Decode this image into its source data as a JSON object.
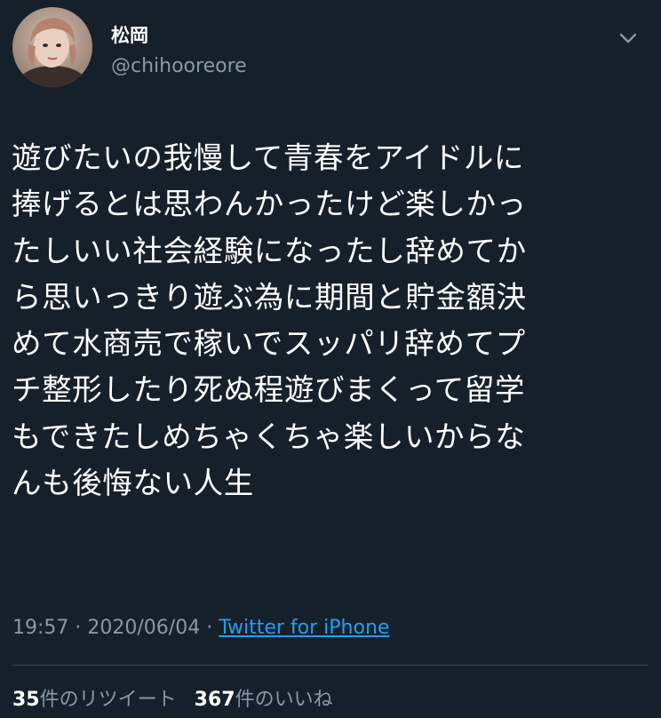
{
  "tweet": {
    "author": {
      "display_name": "松岡",
      "handle": "@chihooreore",
      "avatar_icon": "avatar-photo"
    },
    "menu_icon": "chevron-down-icon",
    "body_lines": [
      "遊びたいの我慢して青春をアイドルに",
      "捧げるとは思わんかったけど楽しかっ",
      "たしいい社会経験になったし辞めてか",
      "ら思いっきり遊ぶ為に期間と貯金額決",
      "めて水商売で稼いでスッパリ辞めてプ",
      "チ整形したり死ぬ程遊びまくって留学",
      "もできたしめちゃくちゃ楽しいからな",
      "んも後悔ない人生"
    ],
    "meta": {
      "time": "19:57",
      "separator": " · ",
      "date": "2020/06/04",
      "source": "Twitter for iPhone"
    },
    "stats": {
      "retweets_count": "35",
      "retweets_label": "件のリツイート",
      "likes_count": "367",
      "likes_label": "件のいいね"
    }
  },
  "colors": {
    "background": "#15202b",
    "text_primary": "#ffffff",
    "text_secondary": "#8899a6",
    "link": "#1da1f2",
    "divider": "#38444d"
  }
}
